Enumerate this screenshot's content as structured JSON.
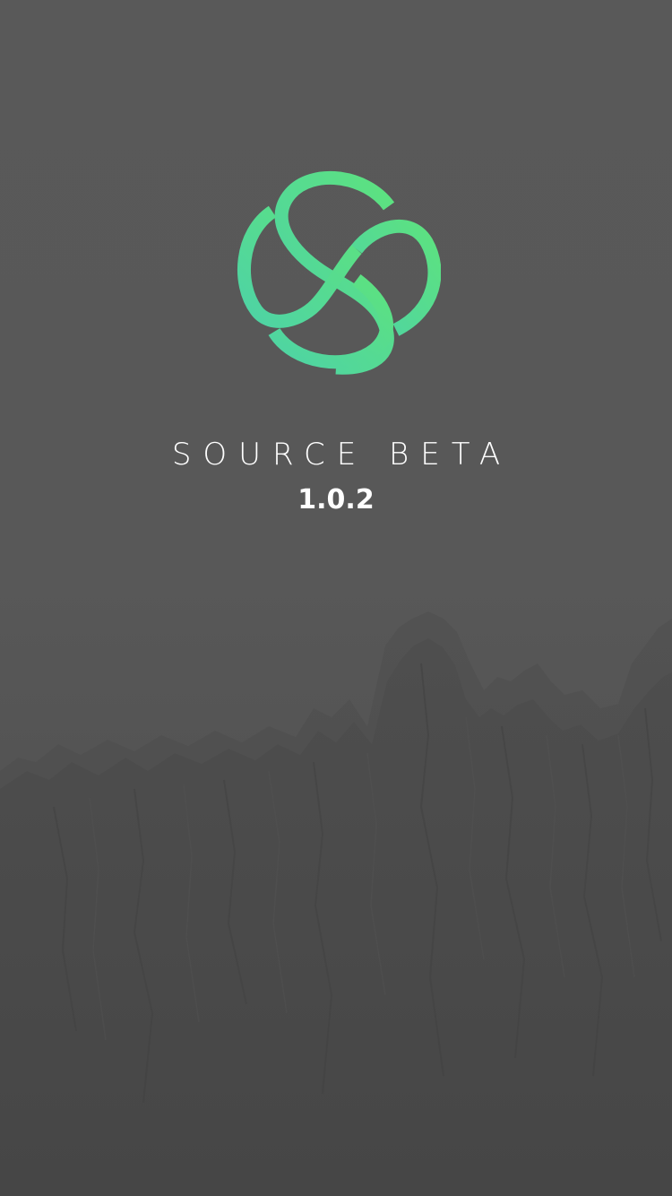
{
  "app": {
    "title": "SOURCE BETA",
    "version": "1.0.2"
  },
  "logo": {
    "icon": "source-logo-icon",
    "gradient_start": "#4ED3A5",
    "gradient_end": "#5DE27F"
  },
  "background": {
    "base_color": "#585858",
    "image": "mountain-range"
  }
}
